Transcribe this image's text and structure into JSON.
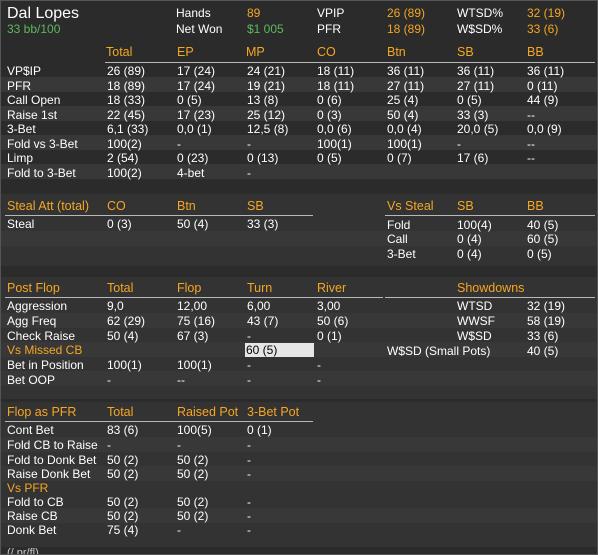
{
  "player": {
    "name": "Dal Lopes",
    "stack": "33 bb/100"
  },
  "summary": [
    {
      "label": "Hands",
      "value": "89"
    },
    {
      "label": "Net Won",
      "value": "$1 005"
    },
    {
      "label": "VPIP",
      "value": "26 (89)"
    },
    {
      "label": "PFR",
      "value": "18 (89)"
    },
    {
      "label": "WTSD%",
      "value": "32 (19)"
    },
    {
      "label": "W$SD%",
      "value": "33 (6)"
    }
  ],
  "preflop": {
    "headers": [
      "Total",
      "EP",
      "MP",
      "CO",
      "Btn",
      "SB",
      "BB"
    ],
    "rows": [
      {
        "label": "VP$IP",
        "cells": [
          "26 (89)",
          "17 (24)",
          "24 (21)",
          "18 (11)",
          "36 (11)",
          "36 (11)",
          "36 (11)"
        ]
      },
      {
        "label": "PFR",
        "cells": [
          "18 (89)",
          "17 (24)",
          "19 (21)",
          "18 (11)",
          "27 (11)",
          "27 (11)",
          "0 (11)"
        ]
      },
      {
        "label": "Call Open",
        "cells": [
          "18 (33)",
          "0 (5)",
          "13 (8)",
          "0 (6)",
          "25 (4)",
          "0 (5)",
          "44 (9)"
        ]
      },
      {
        "label": "Raise 1st",
        "cells": [
          "22 (45)",
          "17 (23)",
          "25 (12)",
          "0 (3)",
          "50 (4)",
          "33 (3)",
          "--"
        ]
      },
      {
        "label": "3-Bet",
        "cells": [
          "6,1 (33)",
          "0,0 (1)",
          "12,5 (8)",
          "0,0 (6)",
          "0,0 (4)",
          "20,0 (5)",
          "0,0 (9)"
        ]
      },
      {
        "label": "Fold vs 3-Bet",
        "cells": [
          "100(2)",
          "-",
          "-",
          "100(1)",
          "100(1)",
          "-",
          "--"
        ]
      },
      {
        "label": "Limp",
        "cells": [
          "2 (54)",
          "0 (23)",
          "0 (13)",
          "0 (5)",
          "0 (7)",
          "17 (6)",
          "--"
        ]
      },
      {
        "label": "Fold to 3-Bet",
        "cells": [
          "100(2)",
          "4-bet",
          "-",
          "",
          "",
          "",
          ""
        ]
      }
    ]
  },
  "steal": {
    "title": "Steal Att (total)",
    "headers": [
      "CO",
      "Btn",
      "SB"
    ],
    "row_label": "Steal",
    "cells": [
      "0 (3)",
      "50 (4)",
      "33 (3)"
    ]
  },
  "vs_steal": {
    "title": "Vs Steal",
    "headers": [
      "SB",
      "BB"
    ],
    "rows": [
      {
        "label": "Fold",
        "cells": [
          "100(4)",
          "40 (5)"
        ]
      },
      {
        "label": "Call",
        "cells": [
          "0 (4)",
          "60 (5)"
        ]
      },
      {
        "label": "3-Bet",
        "cells": [
          "0 (4)",
          "0 (5)"
        ]
      }
    ]
  },
  "postflop": {
    "title": "Post Flop",
    "headers": [
      "Total",
      "Flop",
      "Turn",
      "River"
    ],
    "rows": [
      {
        "label": "Aggression",
        "cells": [
          "9,0",
          "12,00",
          "6,00",
          "3,00"
        ]
      },
      {
        "label": "Agg Freq",
        "cells": [
          "62 (29)",
          "75 (16)",
          "43 (7)",
          "50 (6)"
        ]
      },
      {
        "label": "Check Raise",
        "cells": [
          "50 (4)",
          "67 (3)",
          "-",
          "0 (1)"
        ]
      },
      {
        "label": "Vs Missed CB",
        "cells": [
          "",
          "",
          "60 (5)",
          ""
        ]
      },
      {
        "label": "Bet in Position",
        "cells": [
          "100(1)",
          "100(1)",
          "-",
          "-"
        ]
      },
      {
        "label": "Bet OOP",
        "cells": [
          "-",
          "--",
          "-",
          "-"
        ]
      }
    ]
  },
  "showdowns": {
    "title": "Showdowns",
    "rows": [
      {
        "label": "WTSD",
        "value": "32 (19)"
      },
      {
        "label": "WWSF",
        "value": "58 (19)"
      },
      {
        "label": "W$SD",
        "value": "33 (6)"
      },
      {
        "label": "W$SD (Small Pots)",
        "value": "40 (5)"
      }
    ]
  },
  "flop_pfr": {
    "title": "Flop as PFR",
    "headers": [
      "Total",
      "Raised Pot",
      "3-Bet Pot"
    ],
    "rows": [
      {
        "label": "Cont Bet",
        "cells": [
          "83 (6)",
          "100(5)",
          "0 (1)"
        ]
      },
      {
        "label": "Fold CB to Raise",
        "cells": [
          "-",
          "-",
          "-"
        ]
      },
      {
        "label": "Fold to Donk Bet",
        "cells": [
          "50 (2)",
          "50 (2)",
          "-"
        ]
      },
      {
        "label": "Raise Donk Bet",
        "cells": [
          "50 (2)",
          "50 (2)",
          "-"
        ]
      }
    ],
    "vs_title": "Vs PFR",
    "vs_rows": [
      {
        "label": "Fold to CB",
        "cells": [
          "50 (2)",
          "50 (2)",
          "-"
        ]
      },
      {
        "label": "Raise CB",
        "cells": [
          "50 (2)",
          "50 (2)",
          "-"
        ]
      },
      {
        "label": "Donk Bet",
        "cells": [
          "75 (4)",
          "-",
          "-"
        ]
      }
    ]
  },
  "footer_partial": "(/ pr/fl) ...    ..."
}
